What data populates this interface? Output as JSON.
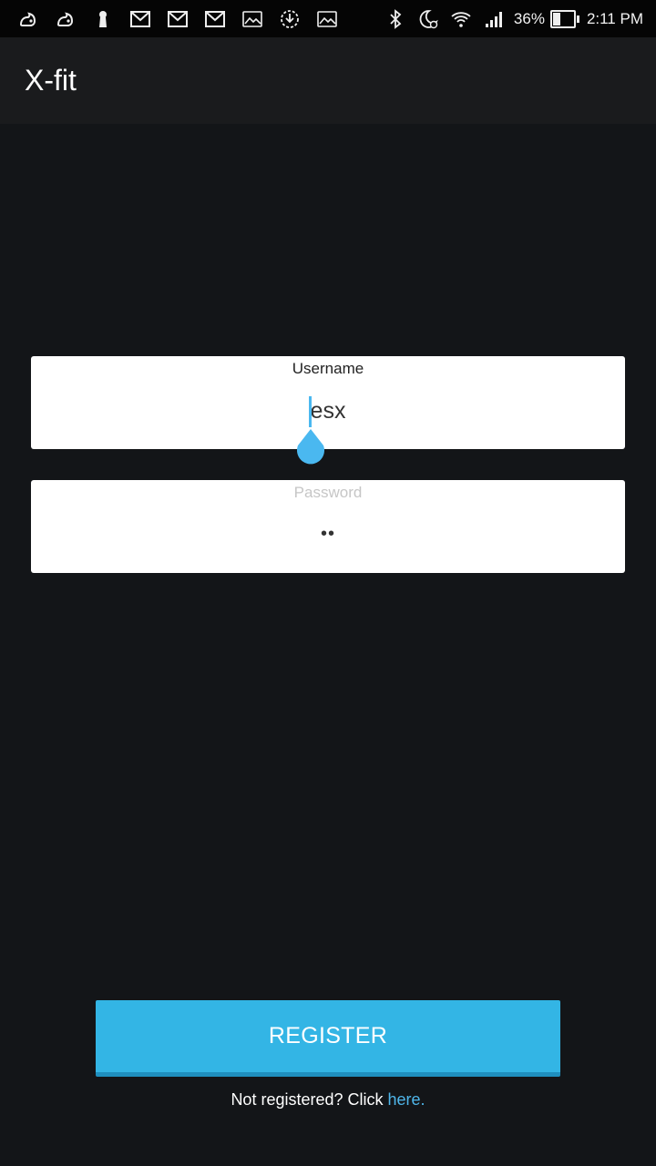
{
  "status_bar": {
    "left_icons": [
      "uc-browser-icon",
      "uc-browser-icon",
      "keyhole-icon",
      "gmail-icon",
      "gmail-icon",
      "gmail-icon",
      "image-icon",
      "download-icon",
      "image-icon"
    ],
    "right_icons": [
      "bluetooth-icon",
      "do-not-disturb-alarm-icon",
      "wifi-icon",
      "signal-icon"
    ],
    "battery_percent": "36%",
    "battery_level": 0.36,
    "time": "2:11 PM"
  },
  "app_bar": {
    "title": "X-fit"
  },
  "form": {
    "username": {
      "label": "Username",
      "value": "esx"
    },
    "password": {
      "label": "Password",
      "value": "••"
    }
  },
  "register_button": {
    "label": "REGISTER"
  },
  "register_note": {
    "text": "Not registered? Click ",
    "link": "here."
  },
  "colors": {
    "accent": "#33b5e5",
    "background": "#131518",
    "app_bar": "#1a1b1d",
    "link": "#4fb6ea"
  }
}
